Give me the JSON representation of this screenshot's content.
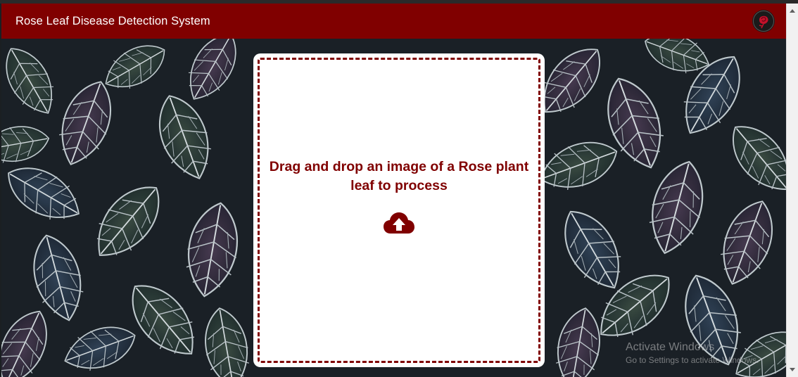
{
  "app": {
    "title": "Rose Leaf Disease Detection System",
    "brand_color": "#800000",
    "logo_icon": "rose-icon"
  },
  "dropzone": {
    "prompt": "Drag and drop an image of a Rose plant leaf to process",
    "icon": "cloud-upload-icon"
  },
  "watermark": {
    "title": "Activate Windows",
    "subtitle": "Go to Settings to activate Windows."
  }
}
